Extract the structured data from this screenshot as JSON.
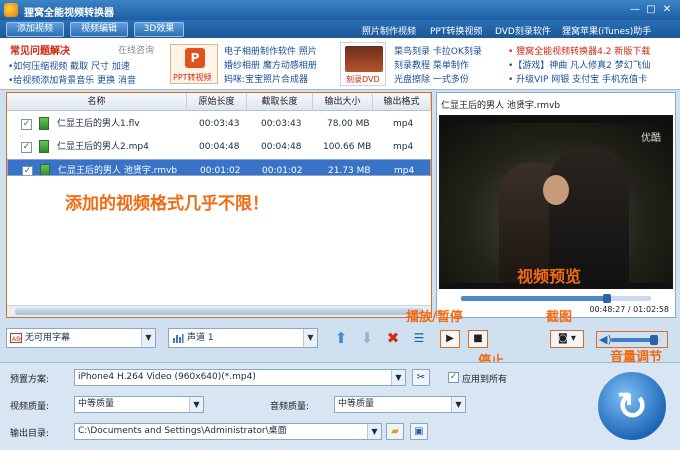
{
  "window": {
    "title": "狸窝全能视频转换器"
  },
  "menu": {
    "buttons": [
      "添加视频",
      "视频编辑",
      "3D效果"
    ],
    "links": [
      "照片制作视频",
      "PPT转换视频",
      "DVD刻录软件",
      "狸窝苹果(iTunes)助手"
    ]
  },
  "banner": {
    "faq_title": "常见问题解决",
    "online_help": "在线咨询",
    "faq_items": [
      "•如何压缩视频  截取  尺寸  加速",
      "•给视频添加背景音乐  更换  消音"
    ],
    "ppt_caption": "PPT转视频",
    "col2": [
      "电子相册制作软件  照片",
      "婚纱相册  魔方动感相册",
      "妈咪:宝宝照片合成器"
    ],
    "dvd_caption": "刻录DVD",
    "col3": [
      "菜鸟刻录  卡拉OK刻录",
      "刻录教程  菜单制作",
      "光盘擦除  一式多份"
    ],
    "col4_top": "• 狸窝全能视频转换器4.2  新版下载",
    "col4": [
      "•【游戏】神曲  凡人修真2  梦幻飞仙",
      "• 升级VIP  网银  支付宝  手机充值卡"
    ]
  },
  "file_list": {
    "columns": [
      "名称",
      "原始长度",
      "截取长度",
      "输出大小",
      "输出格式"
    ],
    "rows": [
      {
        "name": "仁显王后的男人1.flv",
        "orig": "00:03:43",
        "clip": "00:03:43",
        "size": "78.00 MB",
        "fmt": "mp4",
        "checked": true,
        "selected": false
      },
      {
        "name": "仁显王后的男人2.mp4",
        "orig": "00:04:48",
        "clip": "00:04:48",
        "size": "100.66 MB",
        "fmt": "mp4",
        "checked": true,
        "selected": false
      },
      {
        "name": "仁显王后的男人 池贤宇.rmvb",
        "orig": "00:01:02",
        "clip": "00:01:02",
        "size": "21.73 MB",
        "fmt": "mp4",
        "checked": true,
        "selected": true
      }
    ],
    "annotation": "添加的视频格式几乎不限！"
  },
  "list_toolbar": {
    "subtitle": "无可用字幕",
    "audio_track": "声道 1"
  },
  "preview": {
    "title": "仁显王后的男人 池贤宇.rmvb",
    "watermark": "优酷",
    "caption": "视频预览",
    "time": "00:48:27 / 01:02:58",
    "progress": 0.77,
    "volume": 0.85
  },
  "annotations": {
    "play_pause": "播放/暂停",
    "stop": "停止",
    "screenshot": "截图",
    "volume": "音量调节"
  },
  "settings": {
    "preset_label": "预置方案:",
    "preset_value": "iPhone4 H.264 Video (960x640)(*.mp4)",
    "apply_all": "应用到所有",
    "video_quality_label": "视频质量:",
    "video_quality": "中等质量",
    "audio_quality_label": "音频质量:",
    "audio_quality": "中等质量",
    "output_label": "输出目录:",
    "output_dir": "C:\\Documents and Settings\\Administrator\\桌面"
  },
  "colors": {
    "accent": "#f26b10",
    "brand": "#1d5da3",
    "selection": "#3873c7"
  }
}
